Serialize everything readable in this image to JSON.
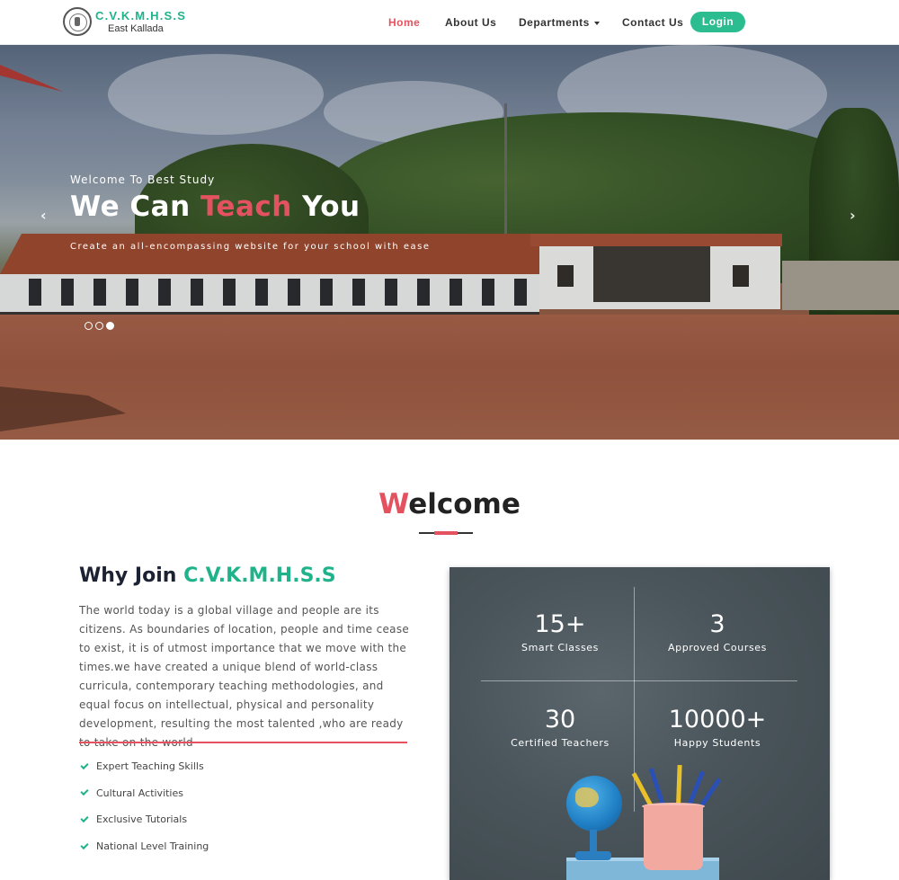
{
  "brand": {
    "title": "C.V.K.M.H.S.S",
    "subtitle": "East Kallada"
  },
  "nav": {
    "items": [
      {
        "label": "Home",
        "active": true
      },
      {
        "label": "About Us"
      },
      {
        "label": "Departments",
        "dropdown": true
      },
      {
        "label": "Contact Us"
      }
    ],
    "login_label": "Login"
  },
  "hero": {
    "kicker": "Welcome To Best Study",
    "title_part1": "We Can ",
    "title_accent": "Teach",
    "title_part2": " You",
    "subtitle": "Create an all-encompassing website for your school with ease",
    "prev_arrow": "‹",
    "next_arrow": "›",
    "slides_total": 3,
    "active_slide": 3
  },
  "welcome": {
    "first_letter": "W",
    "rest": "elcome"
  },
  "why": {
    "title_prefix": "Why Join ",
    "title_brand": "C.V.K.M.H.S.S",
    "paragraph": "The world today is a global village and people are its citizens. As boundaries of location, people and time cease to exist, it is of utmost importance that we move with the times.we have created a unique blend of world-class curricula, contemporary teaching methodologies, and equal focus on intellectual, physical and personality development, resulting the most talented ,who are ready to take on the world",
    "features": [
      "Expert Teaching Skills",
      "Cultural Activities",
      "Exclusive Tutorials",
      "National Level Training"
    ]
  },
  "stats": [
    {
      "value": "15+",
      "label": "Smart Classes"
    },
    {
      "value": "3",
      "label": "Approved Courses"
    },
    {
      "value": "30",
      "label": "Certified Teachers"
    },
    {
      "value": "10000+",
      "label": "Happy Students"
    }
  ],
  "colors": {
    "accent": "#e4525f",
    "brand_green": "#20b28a",
    "login_green": "#2bbd8f"
  },
  "icons": {
    "check": "check-icon",
    "caret": "chevron-down-icon",
    "prev": "chevron-left-icon",
    "next": "chevron-right-icon"
  }
}
